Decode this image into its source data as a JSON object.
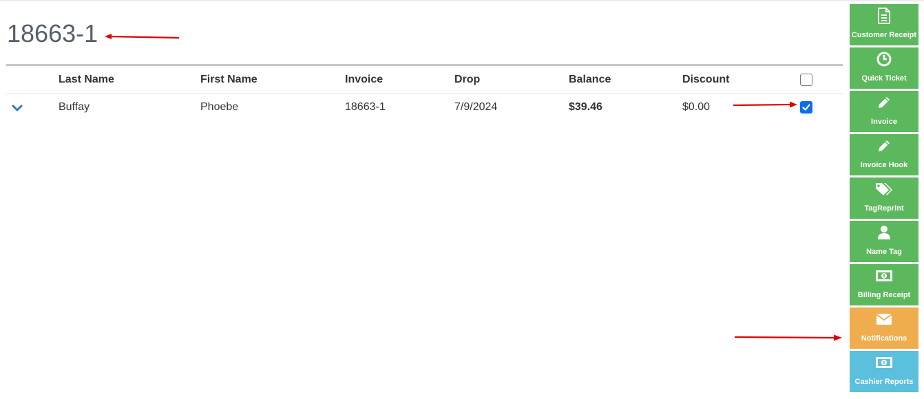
{
  "page": {
    "title": "18663-1"
  },
  "table": {
    "headers": {
      "last_name": "Last Name",
      "first_name": "First Name",
      "invoice": "Invoice",
      "drop": "Drop",
      "balance": "Balance",
      "discount": "Discount"
    },
    "select_all_checked": false,
    "rows": [
      {
        "last_name": "Buffay",
        "first_name": "Phoebe",
        "invoice": "18663-1",
        "drop": "7/9/2024",
        "balance": "$39.46",
        "discount": "$0.00",
        "checked": true
      }
    ]
  },
  "sidebar": {
    "items": [
      {
        "label": "Customer Receipt",
        "icon": "document-icon",
        "color": "#5cb85c"
      },
      {
        "label": "Quick Ticket",
        "icon": "clock-icon",
        "color": "#5cb85c"
      },
      {
        "label": "Invoice",
        "icon": "pencil-icon",
        "color": "#5cb85c"
      },
      {
        "label": "Invoice Hook",
        "icon": "pencil-icon",
        "color": "#5cb85c"
      },
      {
        "label": "TagReprint",
        "icon": "tags-icon",
        "color": "#5cb85c"
      },
      {
        "label": "Name Tag",
        "icon": "user-icon",
        "color": "#5cb85c"
      },
      {
        "label": "Billing Receipt",
        "icon": "money-icon",
        "color": "#5cb85c"
      },
      {
        "label": "Notifications",
        "icon": "envelope-icon",
        "color": "#f0ad4e"
      },
      {
        "label": "Cashier Reports",
        "icon": "money-icon",
        "color": "#5bc0de"
      }
    ]
  },
  "annotations": {
    "arrow_color": "#e00000"
  }
}
